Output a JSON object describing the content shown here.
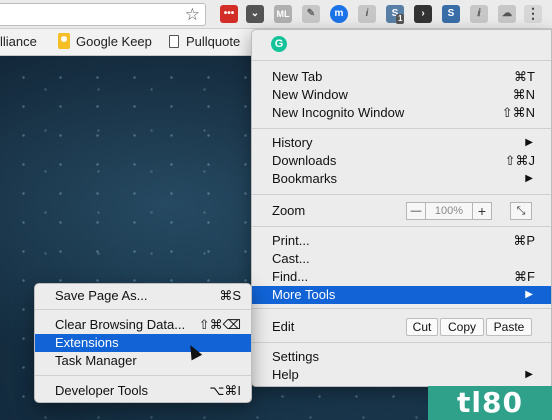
{
  "bookmarks": [
    {
      "label": "lliance",
      "icon": "none"
    },
    {
      "label": "Google Keep",
      "icon": "google-keep-icon"
    },
    {
      "label": "Pullquote",
      "icon": "document-icon"
    }
  ],
  "extensions": [
    {
      "name": "lastpass-icon",
      "color": "#d32d27"
    },
    {
      "name": "pocket-icon",
      "color": "#555555"
    },
    {
      "name": "ml-icon",
      "color": "#b0b0b0"
    },
    {
      "name": "evernote-icon",
      "color": "#9aa0a6"
    },
    {
      "name": "momentum-icon",
      "color": "#1a73e8"
    },
    {
      "name": "readability-icon",
      "color": "#9aa0a6"
    },
    {
      "name": "scribe-icon",
      "color": "#5a7fa6",
      "badge": "1"
    },
    {
      "name": "prompt-icon",
      "color": "#333333"
    },
    {
      "name": "slack-icon",
      "color": "#3a6ea8"
    },
    {
      "name": "feather-icon",
      "color": "#9aa0a6"
    },
    {
      "name": "cloud-icon",
      "color": "#9aa0a6"
    }
  ],
  "grammarly_letter": "G",
  "main_menu": {
    "new_tab": {
      "label": "New Tab",
      "shortcut": "⌘T"
    },
    "new_window": {
      "label": "New Window",
      "shortcut": "⌘N"
    },
    "new_incognito": {
      "label": "New Incognito Window",
      "shortcut": "⇧⌘N"
    },
    "history": {
      "label": "History"
    },
    "downloads": {
      "label": "Downloads",
      "shortcut": "⇧⌘J"
    },
    "bookmarks": {
      "label": "Bookmarks"
    },
    "zoom": {
      "label": "Zoom",
      "minus": "—",
      "value": "100%",
      "plus": "+"
    },
    "print": {
      "label": "Print...",
      "shortcut": "⌘P"
    },
    "cast": {
      "label": "Cast..."
    },
    "find": {
      "label": "Find...",
      "shortcut": "⌘F"
    },
    "more_tools": {
      "label": "More Tools"
    },
    "edit": {
      "label": "Edit",
      "cut": "Cut",
      "copy": "Copy",
      "paste": "Paste"
    },
    "settings": {
      "label": "Settings"
    },
    "help": {
      "label": "Help"
    }
  },
  "sub_menu": {
    "save_page": {
      "label": "Save Page As...",
      "shortcut": "⌘S"
    },
    "clear_data": {
      "label": "Clear Browsing Data...",
      "shortcut": "⇧⌘⌫"
    },
    "extensions": {
      "label": "Extensions"
    },
    "task_manager": {
      "label": "Task Manager"
    },
    "dev_tools": {
      "label": "Developer Tools",
      "shortcut": "⌥⌘I"
    }
  },
  "watermark": "tl80",
  "colors": {
    "highlight": "#1163d6",
    "grammarly": "#15c39a",
    "watermark": "#2fa18a"
  }
}
